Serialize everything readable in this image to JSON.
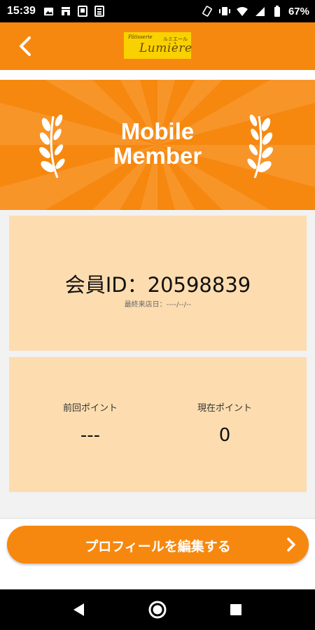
{
  "status_bar": {
    "time": "15:39",
    "battery_percent": "67%",
    "left_icons": [
      "image-icon",
      "store-icon",
      "tablet-icon",
      "calculator-icon"
    ],
    "right_icons": [
      "rotate-icon",
      "vibrate-icon",
      "wifi-icon",
      "signal-icon",
      "battery-icon"
    ]
  },
  "header": {
    "back_icon": "chevron-left-icon",
    "logo": {
      "small_top": "Pâtisserie",
      "brand": "Lumière",
      "small_right": "ルミエール"
    }
  },
  "banner": {
    "title_line1": "Mobile",
    "title_line2": "Member",
    "accent_color": "#F6880F"
  },
  "member": {
    "id_label": "会員ID：20598839",
    "last_visit": "最終来店日：----/--/--"
  },
  "points": {
    "previous_label": "前回ポイント",
    "previous_value": "---",
    "current_label": "現在ポイント",
    "current_value": "0"
  },
  "edit_profile": {
    "label": "プロフィールを編集する",
    "icon": "chevron-right-icon"
  },
  "nav_bar": {
    "icons": [
      "back-triangle-icon",
      "home-circle-icon",
      "recents-square-icon"
    ]
  },
  "colors": {
    "primary": "#F6880F",
    "card": "#FDDDB0",
    "logo_bg": "#F9D100"
  }
}
